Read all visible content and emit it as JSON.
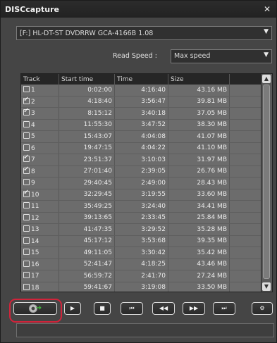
{
  "window": {
    "title": "DISCcapture",
    "close_icon": "close-icon"
  },
  "drive": {
    "selected": "[F:] HL-DT-ST DVDRRW GCA-4166B 1.08"
  },
  "read_speed": {
    "label": "Read Speed :",
    "selected": "Max speed"
  },
  "table": {
    "columns": [
      "Track",
      "Start time",
      "Time",
      "Size"
    ],
    "rows": [
      {
        "track": "1",
        "start": "0:02:00",
        "time": "4:16:40",
        "size": "43.16 MB",
        "checked": false
      },
      {
        "track": "2",
        "start": "4:18:40",
        "time": "3:56:47",
        "size": "39.81 MB",
        "checked": true
      },
      {
        "track": "3",
        "start": "8:15:12",
        "time": "3:40:18",
        "size": "37.05 MB",
        "checked": true
      },
      {
        "track": "4",
        "start": "11:55:30",
        "time": "3:47:52",
        "size": "38.30 MB",
        "checked": false
      },
      {
        "track": "5",
        "start": "15:43:07",
        "time": "4:04:08",
        "size": "41.07 MB",
        "checked": false
      },
      {
        "track": "6",
        "start": "19:47:15",
        "time": "4:04:22",
        "size": "41.10 MB",
        "checked": false
      },
      {
        "track": "7",
        "start": "23:51:37",
        "time": "3:10:03",
        "size": "31.97 MB",
        "checked": true
      },
      {
        "track": "8",
        "start": "27:01:40",
        "time": "2:39:05",
        "size": "26.76 MB",
        "checked": true
      },
      {
        "track": "9",
        "start": "29:40:45",
        "time": "2:49:00",
        "size": "28.43 MB",
        "checked": false
      },
      {
        "track": "10",
        "start": "32:29:45",
        "time": "3:19:55",
        "size": "33.60 MB",
        "checked": true
      },
      {
        "track": "11",
        "start": "35:49:25",
        "time": "3:24:40",
        "size": "34.41 MB",
        "checked": false
      },
      {
        "track": "12",
        "start": "39:13:65",
        "time": "2:33:45",
        "size": "25.84 MB",
        "checked": false
      },
      {
        "track": "13",
        "start": "41:47:35",
        "time": "3:29:52",
        "size": "35.28 MB",
        "checked": false
      },
      {
        "track": "14",
        "start": "45:17:12",
        "time": "3:53:68",
        "size": "39.35 MB",
        "checked": false
      },
      {
        "track": "15",
        "start": "49:11:05",
        "time": "3:30:42",
        "size": "35.42 MB",
        "checked": false
      },
      {
        "track": "16",
        "start": "52:41:47",
        "time": "4:18:25",
        "size": "43.46 MB",
        "checked": false
      },
      {
        "track": "17",
        "start": "56:59:72",
        "time": "2:41:70",
        "size": "27.24 MB",
        "checked": false
      },
      {
        "track": "18",
        "start": "59:41:67",
        "time": "3:19:08",
        "size": "33.50 MB",
        "checked": false
      }
    ]
  },
  "controls": {
    "capture": "disc-capture-icon",
    "play": "▶",
    "stop": "■",
    "first": "⏮",
    "rewind": "◀◀",
    "forward": "▶▶",
    "last": "⏭",
    "settings": "⚙"
  },
  "colors": {
    "highlight_ring": "#d2233a",
    "arrow_green": "#3fb83a"
  }
}
